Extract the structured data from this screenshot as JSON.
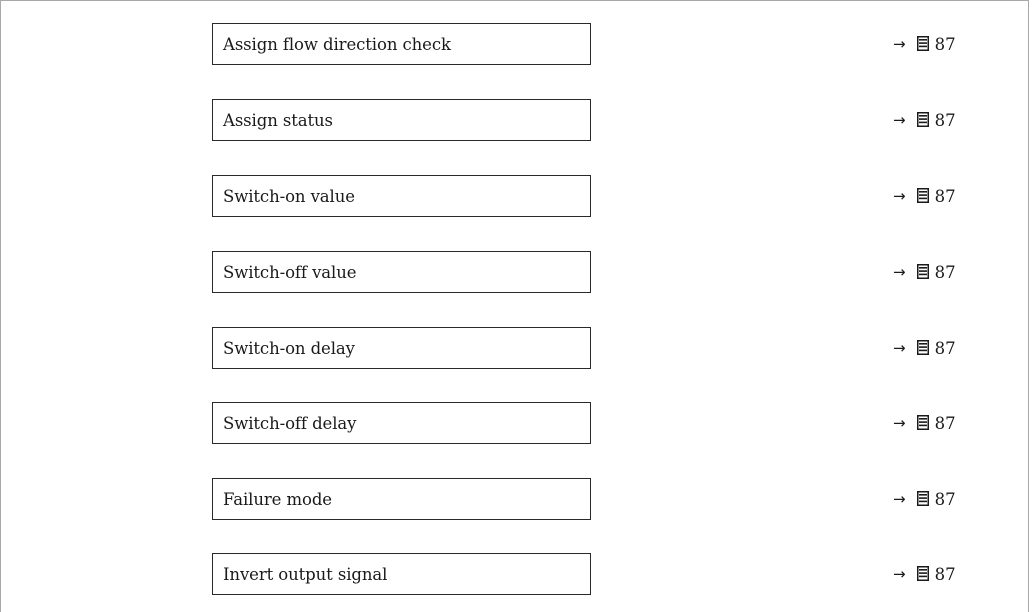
{
  "parameters": [
    {
      "label": "Assign flow direction check",
      "page": "87"
    },
    {
      "label": "Assign status",
      "page": "87"
    },
    {
      "label": "Switch-on value",
      "page": "87"
    },
    {
      "label": "Switch-off value",
      "page": "87"
    },
    {
      "label": "Switch-on delay",
      "page": "87"
    },
    {
      "label": "Switch-off delay",
      "page": "87"
    },
    {
      "label": "Failure mode",
      "page": "87"
    },
    {
      "label": "Invert output signal",
      "page": "87"
    }
  ],
  "reference": {
    "arrow": "→",
    "icon": "page-reference-icon"
  }
}
